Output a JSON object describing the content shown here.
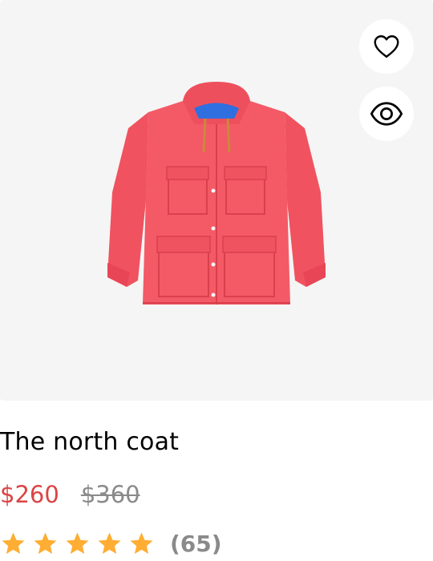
{
  "product": {
    "name": "The north coat",
    "price": "$260",
    "old_price": "$360",
    "review_count": "(65)",
    "rating": 5,
    "rating_max": 5,
    "image_icon": "red-hooded-coat-image"
  },
  "actions": {
    "wishlist_icon": "heart-icon",
    "quickview_icon": "eye-icon"
  },
  "colors": {
    "price": "#db4444",
    "old_price": "#8a8a8a",
    "star": "#ffad33",
    "image_background": "#f5f5f5"
  }
}
